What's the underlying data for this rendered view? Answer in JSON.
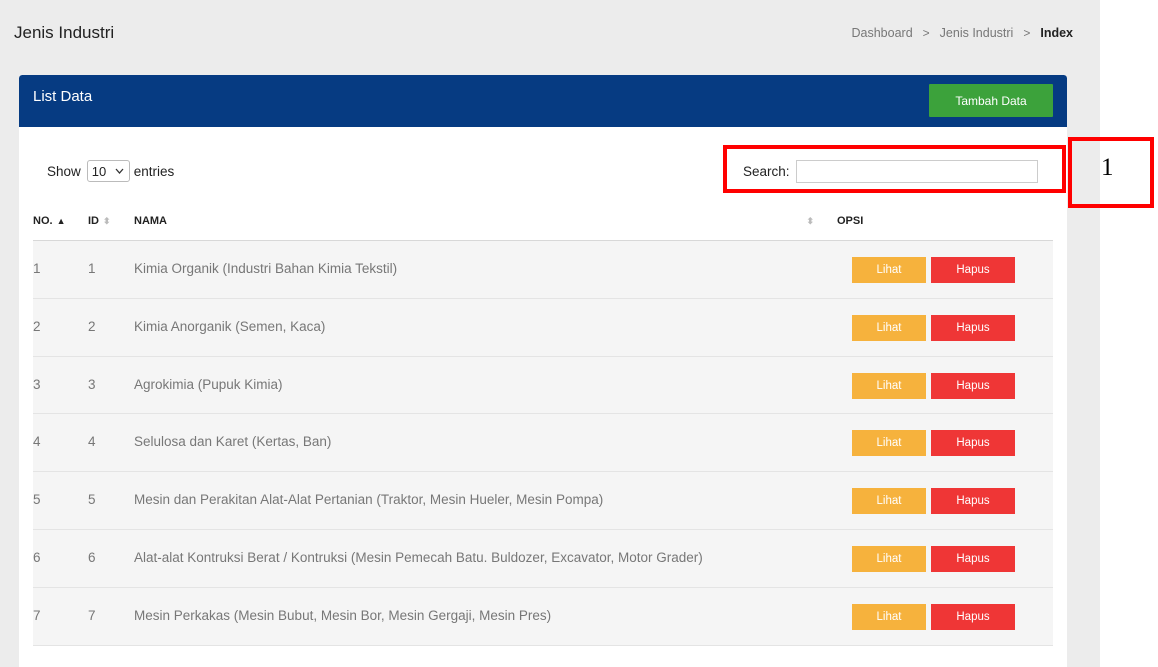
{
  "header": {
    "title": "Jenis Industri",
    "breadcrumb": [
      "Dashboard",
      "Jenis Industri",
      "Index"
    ],
    "breadcrumb_sep": ">"
  },
  "card": {
    "title": "List Data",
    "add_button": "Tambah Data"
  },
  "controls": {
    "show_label": "Show",
    "entries_value": "10",
    "entries_label": "entries",
    "search_label": "Search:",
    "search_value": ""
  },
  "table": {
    "columns": [
      "NO.",
      "ID",
      "NAMA",
      "OPSI"
    ],
    "rows": [
      {
        "no": "1",
        "id": "1",
        "nama": "Kimia Organik (Industri Bahan Kimia Tekstil)"
      },
      {
        "no": "2",
        "id": "2",
        "nama": "Kimia Anorganik (Semen, Kaca)"
      },
      {
        "no": "3",
        "id": "3",
        "nama": "Agrokimia (Pupuk Kimia)"
      },
      {
        "no": "4",
        "id": "4",
        "nama": "Selulosa dan Karet (Kertas, Ban)"
      },
      {
        "no": "5",
        "id": "5",
        "nama": "Mesin dan Perakitan Alat-Alat Pertanian (Traktor, Mesin Hueler, Mesin Pompa)"
      },
      {
        "no": "6",
        "id": "6",
        "nama": "Alat-alat Kontruksi Berat / Kontruksi (Mesin Pemecah Batu. Buldozer, Excavator, Motor Grader)"
      },
      {
        "no": "7",
        "id": "7",
        "nama": "Mesin Perkakas (Mesin Bubut, Mesin Bor, Mesin Gergaji, Mesin Pres)"
      }
    ],
    "btn_lihat": "Lihat",
    "btn_hapus": "Hapus"
  },
  "annotation": {
    "label": "1"
  },
  "colors": {
    "header_blue": "#063b82",
    "add_green": "#3ca23b",
    "lihat_orange": "#f6b23d",
    "hapus_red": "#ef3636",
    "annotation_red": "#ff0000"
  }
}
